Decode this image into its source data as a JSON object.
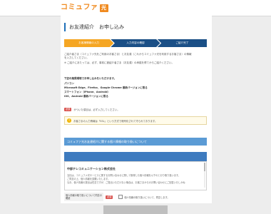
{
  "brand": {
    "logo_text": "コミュファ",
    "logo_badge": "光"
  },
  "page": {
    "title": "お友達紹介　お申し込み"
  },
  "steps": [
    {
      "label": "お客様情報の入力",
      "state": "active"
    },
    {
      "label": "入力内容の確認",
      "state": "inactive"
    },
    {
      "label": "ご紹介完了",
      "state": "inactive"
    }
  ],
  "intro": [
    "ご紹介者さま（コミュファ光をご利用のお客さま）とお友達（これからコミュファ光を利用するお客さま）の情報",
    "を入力してください。",
    "※ ご紹介にあたっては、必ず、事前に被紹介者さま（お友達）の承諾を得てからご紹介ください。"
  ],
  "env": {
    "heading": "下記の推奨環境でお申し込みをいただけます。",
    "pc_label": "パソコン",
    "pc_browsers": "Microsoft Edge、Firefox、Google Chrome 最新バージョンに限る",
    "sp_label": "スマートフォン（iPhone、Android）",
    "ios": "iOS、Android 最新バージョンに限る"
  },
  "required_notice": {
    "badge": "必須",
    "text": "がついた項目は、必ず入力してください。"
  },
  "warning": {
    "text": "お客さまの入力情報は「SSL」という方式で暗号化されて守られております。"
  },
  "section1": {
    "title": "コミュファ光お友達紹介に関する個人情報の取り扱いについて"
  },
  "privacy": {
    "company": "中部テレコミュニケーション株式会社",
    "p1": "当社は、コミュファ光サービスに関するお問い合わせに際して取得した個人情報を以下のとおり取り扱います。",
    "p2": "ご同意の上、個人情報を頂戴いたします。",
    "p3": "なお、個人情報の提出は任意ですが、ご提出いただけない場合は、お客さまからのお問い合わせにご回答いたしかね"
  },
  "agree": {
    "label": "個人情報の取り扱いについて同意の確認",
    "badge": "必須",
    "checkbox_text": "個人情報の取り扱いについて、同意します。"
  }
}
